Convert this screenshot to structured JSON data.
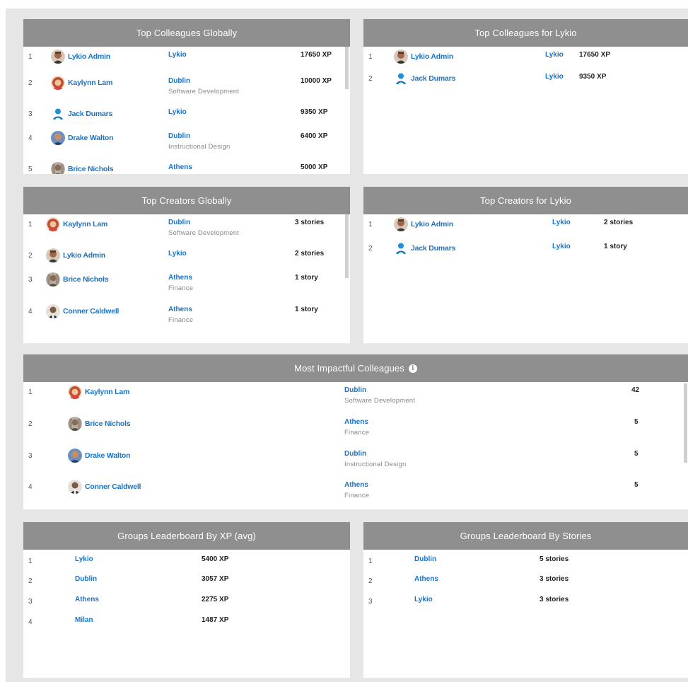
{
  "top_colleagues_global": {
    "title": "Top Colleagues Globally",
    "rows": [
      {
        "rank": "1",
        "name": "Lykio Admin",
        "location": "Lykio",
        "dept": "",
        "value": "17650 XP",
        "avatar": "avatar-admin"
      },
      {
        "rank": "2",
        "name": "Kaylynn Lam",
        "location": "Dublin",
        "dept": "Software Development",
        "value": "10000 XP",
        "avatar": "avatar-kaylynn"
      },
      {
        "rank": "3",
        "name": "Jack Dumars",
        "location": "Lykio",
        "dept": "",
        "value": "9350 XP",
        "avatar": "avatar-generic"
      },
      {
        "rank": "4",
        "name": "Drake Walton",
        "location": "Dublin",
        "dept": "Instructional Design",
        "value": "6400 XP",
        "avatar": "avatar-drake"
      },
      {
        "rank": "5",
        "name": "Brice Nichols",
        "location": "Athens",
        "dept": "",
        "value": "5000 XP",
        "avatar": "avatar-brice"
      }
    ]
  },
  "top_colleagues_lykio": {
    "title": "Top Colleagues for Lykio",
    "rows": [
      {
        "rank": "1",
        "name": "Lykio Admin",
        "location": "Lykio",
        "value": "17650 XP"
      },
      {
        "rank": "2",
        "name": "Jack Dumars",
        "location": "Lykio",
        "value": "9350 XP"
      }
    ]
  },
  "top_creators_global": {
    "title": "Top Creators Globally",
    "rows": [
      {
        "rank": "1",
        "name": "Kaylynn Lam",
        "location": "Dublin",
        "dept": "Software Development",
        "value": "3 stories"
      },
      {
        "rank": "2",
        "name": "Lykio Admin",
        "location": "Lykio",
        "dept": "",
        "value": "2 stories"
      },
      {
        "rank": "3",
        "name": "Brice Nichols",
        "location": "Athens",
        "dept": "Finance",
        "value": "1 story"
      },
      {
        "rank": "4",
        "name": "Conner Caldwell",
        "location": "Athens",
        "dept": "Finance",
        "value": "1 story"
      }
    ]
  },
  "top_creators_lykio": {
    "title": "Top Creators for Lykio",
    "rows": [
      {
        "rank": "1",
        "name": "Lykio Admin",
        "location": "Lykio",
        "value": "2 stories"
      },
      {
        "rank": "2",
        "name": "Jack Dumars",
        "location": "Lykio",
        "value": "1 story"
      }
    ]
  },
  "most_impactful": {
    "title": "Most Impactful Colleagues",
    "info_icon": "i",
    "rows": [
      {
        "rank": "1",
        "name": "Kaylynn Lam",
        "location": "Dublin",
        "dept": "Software Development",
        "value": "42"
      },
      {
        "rank": "2",
        "name": "Brice Nichols",
        "location": "Athens",
        "dept": "Finance",
        "value": "5"
      },
      {
        "rank": "3",
        "name": "Drake Walton",
        "location": "Dublin",
        "dept": "Instructional Design",
        "value": "5"
      },
      {
        "rank": "4",
        "name": "Conner Caldwell",
        "location": "Athens",
        "dept": "Finance",
        "value": "5"
      }
    ]
  },
  "groups_xp": {
    "title": "Groups Leaderboard By XP (avg)",
    "rows": [
      {
        "rank": "1",
        "group": "Lykio",
        "value": "5400 XP"
      },
      {
        "rank": "2",
        "group": "Dublin",
        "value": "3057 XP"
      },
      {
        "rank": "3",
        "group": "Athens",
        "value": "2275 XP"
      },
      {
        "rank": "4",
        "group": "Milan",
        "value": "1487 XP"
      }
    ]
  },
  "groups_stories": {
    "title": "Groups Leaderboard By Stories",
    "rows": [
      {
        "rank": "1",
        "group": "Dublin",
        "value": "5 stories"
      },
      {
        "rank": "2",
        "group": "Athens",
        "value": "3 stories"
      },
      {
        "rank": "3",
        "group": "Lykio",
        "value": "3 stories"
      }
    ]
  },
  "colors": {
    "header_bg": "#8f8f8f",
    "link": "#1a73c6",
    "page_bg": "#e6e6e6"
  }
}
